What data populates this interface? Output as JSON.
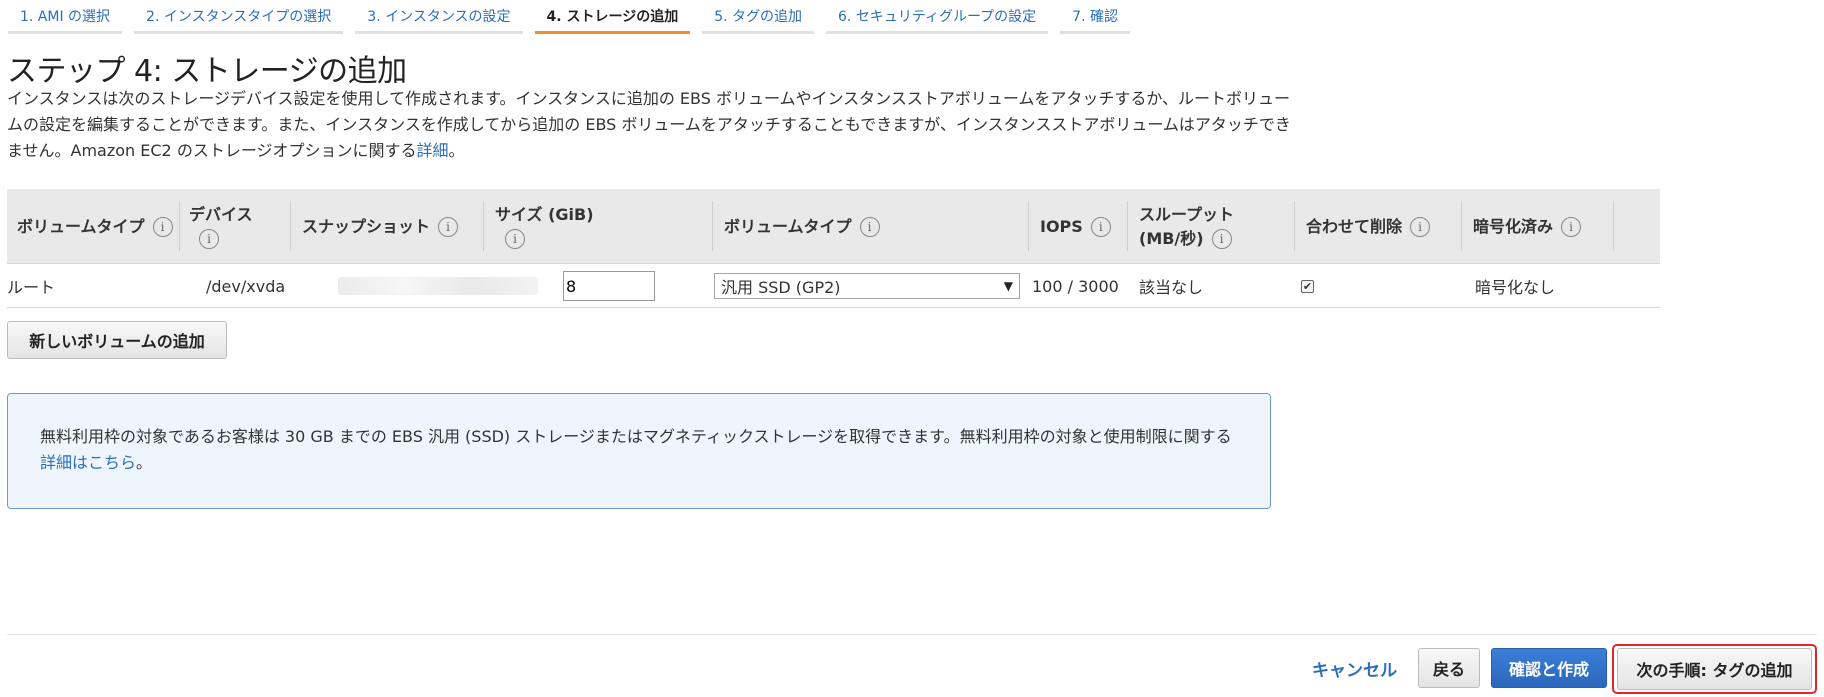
{
  "steps": [
    {
      "label": "1. AMI の選択",
      "active": false
    },
    {
      "label": "2. インスタンスタイプの選択",
      "active": false
    },
    {
      "label": "3. インスタンスの設定",
      "active": false
    },
    {
      "label": "4. ストレージの追加",
      "active": true
    },
    {
      "label": "5. タグの追加",
      "active": false
    },
    {
      "label": "6. セキュリティグループの設定",
      "active": false
    },
    {
      "label": "7. 確認",
      "active": false
    }
  ],
  "page": {
    "title": "ステップ 4: ストレージの追加",
    "description": "インスタンスは次のストレージデバイス設定を使用して作成されます。インスタンスに追加の EBS ボリュームやインスタンスストアボリュームをアタッチするか、ルートボリュームの設定を編集することができます。また、インスタンスを作成してから追加の EBS ボリュームをアタッチすることもできますが、インスタンスストアボリュームはアタッチできません。Amazon EC2 のストレージオプションに関する",
    "description_link": "詳細",
    "description_end": "。"
  },
  "table": {
    "headers": {
      "volume_type": "ボリュームタイプ",
      "device": "デバイス",
      "snapshot": "スナップショット",
      "size": "サイズ (GiB)",
      "volume_kind": "ボリュームタイプ",
      "iops": "IOPS",
      "throughput_l1": "スループット",
      "throughput_l2": "(MB/秒)",
      "delete_on_termination": "合わせて削除",
      "encrypted": "暗号化済み"
    },
    "info_glyph": "i",
    "row": {
      "volume_type": "ルート",
      "device": "/dev/xvda",
      "size": "8",
      "volume_kind": "汎用 SSD (GP2)",
      "iops": "100 / 3000",
      "throughput": "該当なし",
      "delete_checked": "✔",
      "encrypted": "暗号化なし"
    }
  },
  "add_volume_button": "新しいボリュームの追加",
  "notice": {
    "text": "無料利用枠の対象であるお客様は 30 GB までの EBS 汎用 (SSD) ストレージまたはマグネティックストレージを取得できます。無料利用枠の対象と使用制限に関する",
    "link": "詳細はこちら",
    "end": "。"
  },
  "footer": {
    "cancel": "キャンセル",
    "back": "戻る",
    "review_launch": "確認と作成",
    "next": "次の手順: タグの追加"
  },
  "colors": {
    "link": "#2a6fbc",
    "active_step": "#f0922b",
    "primary_button": "#2b67bc",
    "highlight": "#e4252e"
  }
}
